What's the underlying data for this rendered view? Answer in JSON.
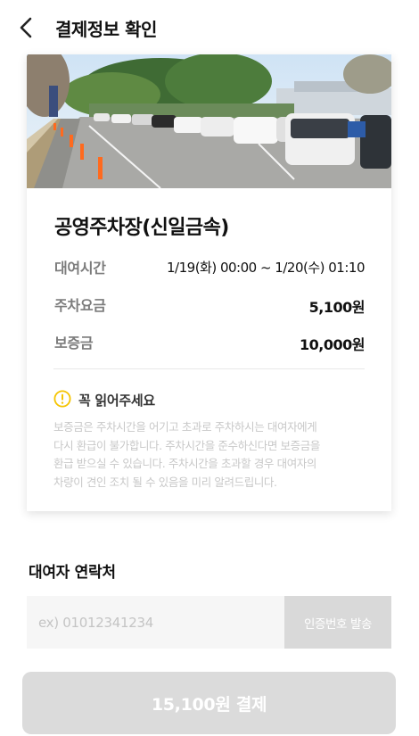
{
  "header": {
    "title": "결제정보 확인",
    "back_icon": "chevron-left-icon"
  },
  "parking": {
    "name": "공영주차장(신일금속)",
    "photo": "parking-lot-photo",
    "rows": [
      {
        "label": "대여시간",
        "value": "1/19(화) 00:00 ~ 1/20(수) 01:10"
      },
      {
        "label": "주차요금",
        "value": "5,100원"
      },
      {
        "label": "보증금",
        "value": "10,000원"
      }
    ]
  },
  "notice": {
    "icon": "warning-circle-icon",
    "accent_color": "#f5c400",
    "title": "꼭 읽어주세요",
    "lines": [
      "보증금은 주차시간을 어기고 초과로 주차하시는 대여자에게",
      "다시 환급이 불가합니다. 주차시간을 준수하신다면 보증금을",
      "환급 받으실 수 있습니다. 주차시간을 초과할 경우 대여자의",
      "차량이 견인 조치 될 수 있음을 미리 알려드립니다."
    ]
  },
  "contact": {
    "title": "대여자 연락처",
    "phone_placeholder": "ex) 01012341234",
    "phone_value": "",
    "verify_label": "인증번호 발송"
  },
  "payment": {
    "label": "15,100원 결제",
    "button_color": "#dbdbdb"
  }
}
